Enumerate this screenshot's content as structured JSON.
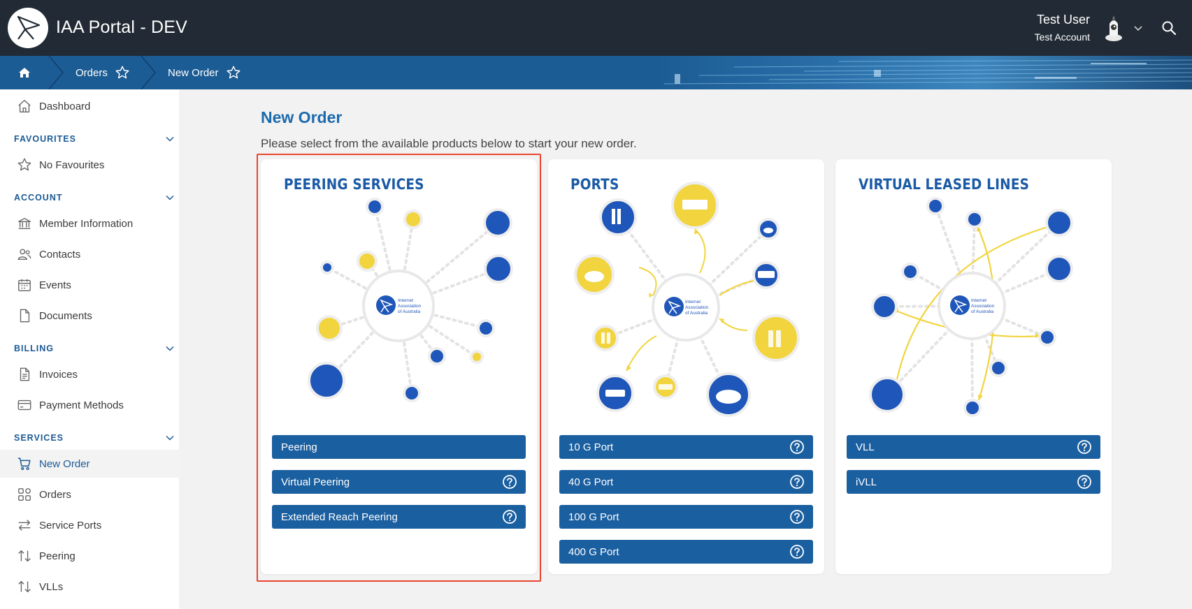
{
  "app": {
    "title": "IAA Portal - DEV"
  },
  "user": {
    "name": "Test User",
    "account": "Test Account"
  },
  "breadcrumb": [
    {
      "label": "Orders"
    },
    {
      "label": "New Order"
    }
  ],
  "sidebar": {
    "dashboard": "Dashboard",
    "favourites": {
      "title": "FAVOURITES",
      "items": [
        {
          "label": "No Favourites"
        }
      ]
    },
    "account": {
      "title": "ACCOUNT",
      "items": [
        {
          "label": "Member Information"
        },
        {
          "label": "Contacts"
        },
        {
          "label": "Events"
        },
        {
          "label": "Documents"
        }
      ]
    },
    "billing": {
      "title": "BILLING",
      "items": [
        {
          "label": "Invoices"
        },
        {
          "label": "Payment Methods"
        }
      ]
    },
    "services": {
      "title": "SERVICES",
      "items": [
        {
          "label": "New Order"
        },
        {
          "label": "Orders"
        },
        {
          "label": "Service Ports"
        },
        {
          "label": "Peering"
        },
        {
          "label": "VLLs"
        }
      ]
    }
  },
  "main": {
    "title": "New Order",
    "subtitle": "Please select from the available products below to start your new order.",
    "cards": [
      {
        "title": "PEERING SERVICES",
        "logo_text": "Internet Association of Australia",
        "products": [
          {
            "label": "Peering"
          },
          {
            "label": "Virtual Peering"
          },
          {
            "label": "Extended Reach Peering"
          }
        ]
      },
      {
        "title": "PORTS",
        "logo_text": "Internet Association of Australia",
        "products": [
          {
            "label": "10 G Port"
          },
          {
            "label": "40 G Port"
          },
          {
            "label": "100 G Port"
          },
          {
            "label": "400 G Port"
          }
        ]
      },
      {
        "title": "VIRTUAL LEASED LINES",
        "logo_text": "Internet Association of Australia",
        "products": [
          {
            "label": "VLL"
          },
          {
            "label": "iVLL"
          }
        ]
      }
    ]
  },
  "colors": {
    "header_bg": "#222b35",
    "primary": "#1a5fa0",
    "accent_yellow": "#f2d43e",
    "node_blue": "#1f56b9",
    "highlight": "#e8452e"
  },
  "icons": [
    "logo-icon",
    "home-icon",
    "star-icon",
    "chevron-down-icon",
    "search-icon",
    "bank-icon",
    "contacts-icon",
    "calendar-icon",
    "document-icon",
    "invoice-icon",
    "credit-card-icon",
    "cart-icon",
    "grid-icon",
    "arrows-icon",
    "sort-icon",
    "help-icon"
  ]
}
